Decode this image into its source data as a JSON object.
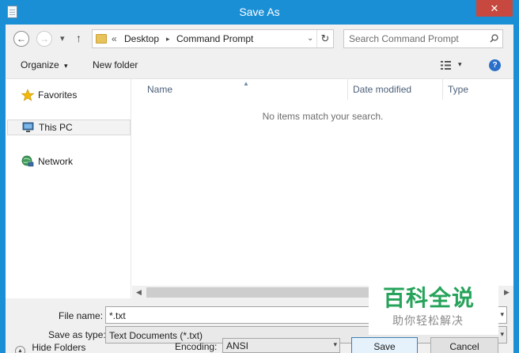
{
  "window": {
    "title": "Save As",
    "close_glyph": "✕"
  },
  "nav": {
    "back_glyph": "←",
    "forward_glyph": "→",
    "recent_glyph": "▾",
    "up_glyph": "↑",
    "breadcrumb_prefix": "«",
    "breadcrumb": [
      "Desktop",
      "Command Prompt"
    ],
    "breadcrumb_sep": "▸",
    "address_dropdown_glyph": "⌄",
    "refresh_glyph": "↻",
    "search_placeholder": "Search Command Prompt"
  },
  "toolbar": {
    "organize_label": "Organize",
    "organize_glyph": "▾",
    "new_folder_label": "New folder",
    "view_drop_glyph": "▾",
    "help_glyph": "?"
  },
  "sidebar": {
    "items": [
      {
        "label": "Favorites",
        "icon": "star-icon"
      },
      {
        "label": "This PC",
        "icon": "computer-icon"
      },
      {
        "label": "Network",
        "icon": "network-icon"
      }
    ]
  },
  "files": {
    "columns": [
      "Name",
      "Date modified",
      "Type"
    ],
    "sort_glyph": "▲",
    "empty_message": "No items match your search.",
    "scroll_left_glyph": "◀",
    "scroll_right_glyph": "▶"
  },
  "form": {
    "file_name_label": "File name:",
    "file_name_value": "*.txt",
    "save_as_type_label": "Save as type:",
    "save_as_type_value": "Text Documents (*.txt)",
    "dropdown_glyph": "▾",
    "hide_folders_label": "Hide Folders",
    "hide_folders_glyph": "▲",
    "encoding_label": "Encoding:",
    "encoding_value": "ANSI",
    "save_label": "Save",
    "cancel_label": "Cancel"
  },
  "watermark": {
    "title": "百科全说",
    "subtitle": "助你轻松解决"
  },
  "colors": {
    "titlebar": "#1b8fd6",
    "close": "#c7483e",
    "star": "#f2b807",
    "watermark_green": "#27a35b"
  }
}
